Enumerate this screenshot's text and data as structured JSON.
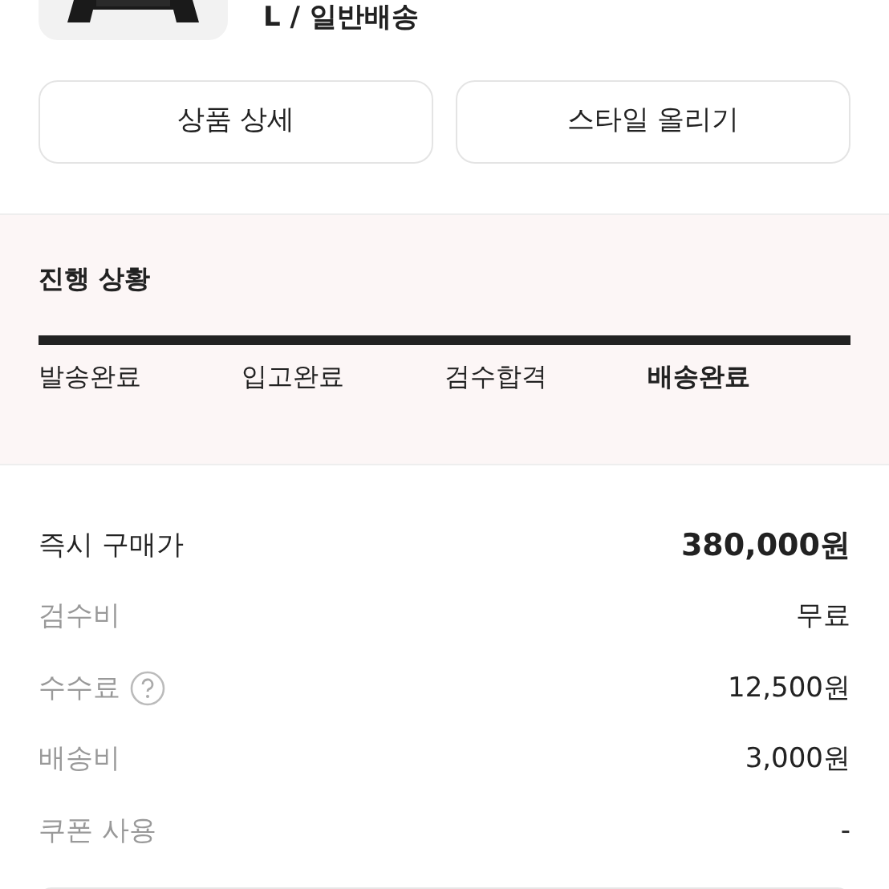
{
  "product": {
    "option": "L / 일반배송"
  },
  "buttons": [
    "상품 상세",
    "스타일 올리기"
  ],
  "progress": {
    "title": "진행 상황",
    "steps": [
      {
        "label": "발송완료",
        "selected": false
      },
      {
        "label": "입고완료",
        "selected": false
      },
      {
        "label": "검수합격",
        "selected": false
      },
      {
        "label": "배송완료",
        "selected": true
      }
    ]
  },
  "price_rows": [
    {
      "kind": "total",
      "label": "즉시 구매가",
      "value": "380,000원"
    },
    {
      "kind": "item",
      "label": "검수비",
      "value": "무료"
    },
    {
      "kind": "help",
      "label": "수수료",
      "value": "12,500원"
    },
    {
      "kind": "item",
      "label": "배송비",
      "value": "3,000원"
    },
    {
      "kind": "item",
      "label": "쿠폰 사용",
      "value": "-"
    }
  ]
}
